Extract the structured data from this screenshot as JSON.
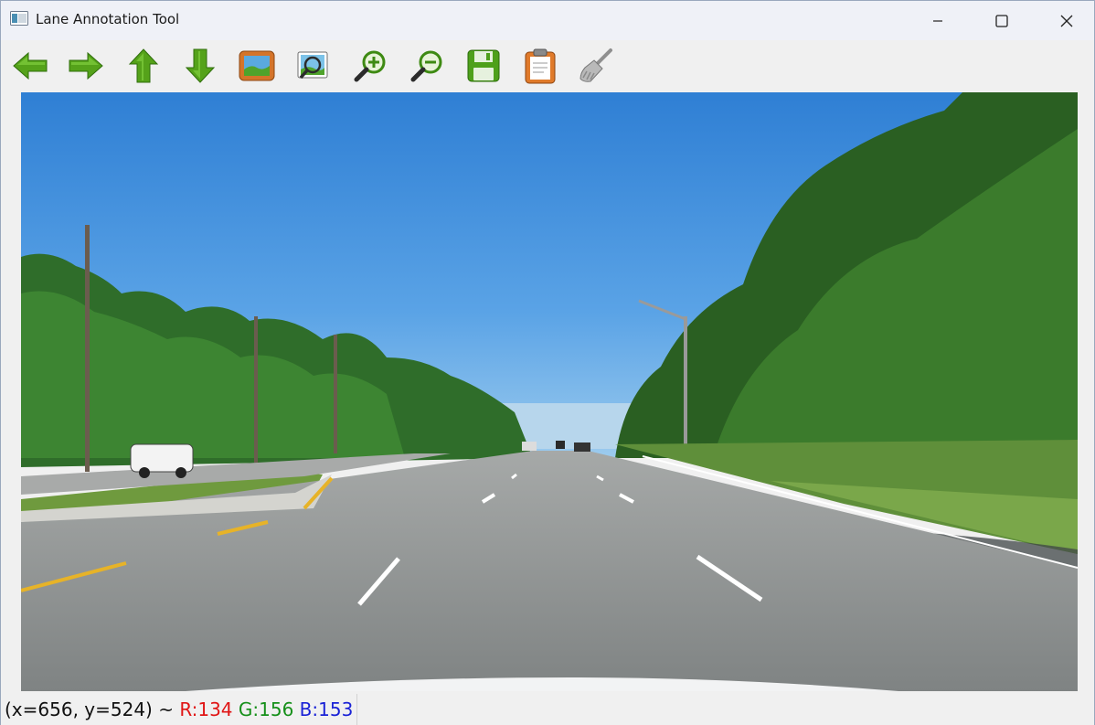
{
  "window": {
    "title": "Lane Annotation Tool",
    "icon": "app-window-icon"
  },
  "window_controls": [
    {
      "name": "minimize",
      "icon": "minimize-icon"
    },
    {
      "name": "maximize",
      "icon": "maximize-icon"
    },
    {
      "name": "close",
      "icon": "close-icon"
    }
  ],
  "toolbar": {
    "tools": [
      {
        "name": "previous-image",
        "icon": "arrow-left-icon"
      },
      {
        "name": "next-image",
        "icon": "arrow-right-icon"
      },
      {
        "name": "move-up",
        "icon": "arrow-up-icon"
      },
      {
        "name": "move-down",
        "icon": "arrow-down-icon"
      },
      {
        "name": "open-image",
        "icon": "image-icon"
      },
      {
        "name": "fit-view",
        "icon": "image-zoom-icon"
      },
      {
        "name": "zoom-in",
        "icon": "zoom-in-icon"
      },
      {
        "name": "zoom-out",
        "icon": "zoom-out-icon"
      },
      {
        "name": "save",
        "icon": "save-icon"
      },
      {
        "name": "clipboard",
        "icon": "clipboard-icon"
      },
      {
        "name": "clear",
        "icon": "broom-icon"
      }
    ]
  },
  "status": {
    "coords": "(x=656, y=524) ~ ",
    "r": "R:134",
    "g": "G:156",
    "b": "B:153",
    "colors": {
      "r": "#e01515",
      "g": "#16901a",
      "b": "#1a22d6"
    }
  },
  "canvas": {
    "content": "road-scene-image"
  }
}
